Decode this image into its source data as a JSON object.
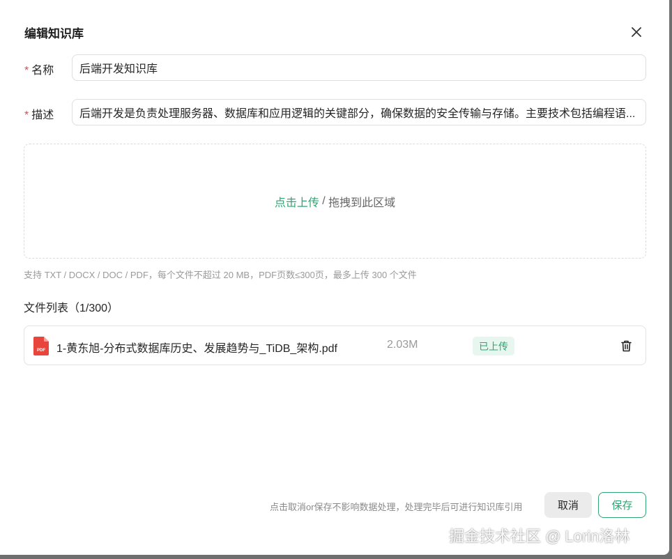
{
  "dialog": {
    "title": "编辑知识库",
    "close_icon": "close-icon"
  },
  "form": {
    "required_mark": "*",
    "name_label": "名称",
    "name_value": "后端开发知识库",
    "desc_label": "描述",
    "desc_value": "后端开发是负责处理服务器、数据库和应用逻辑的关键部分，确保数据的安全传输与存储。主要技术包括编程语..."
  },
  "upload": {
    "click_label": "点击上传",
    "separator": " / ",
    "drag_label": "拖拽到此区域",
    "hint": "支持 TXT / DOCX / DOC / PDF，每个文件不超过 20 MB，PDF页数≤300页，最多上传 300 个文件"
  },
  "file_list": {
    "title": "文件列表（1/300）",
    "files": [
      {
        "icon": "pdf-file-icon",
        "name": "1-黄东旭-分布式数据库历史、发展趋势与_TiDB_架构.pdf",
        "size": "2.03M",
        "status": "已上传",
        "delete_icon": "trash-icon"
      }
    ]
  },
  "footer": {
    "hint": "点击取消or保存不影响数据处理，处理完毕后可进行知识库引用",
    "cancel_label": "取消",
    "save_label": "保存"
  },
  "watermark": "掘金技术社区 @ Lorin洛林",
  "colors": {
    "accent": "#2ea572",
    "required": "#e5484d",
    "badge_bg": "#e7f6ee",
    "pdf_icon": "#e8453c"
  }
}
